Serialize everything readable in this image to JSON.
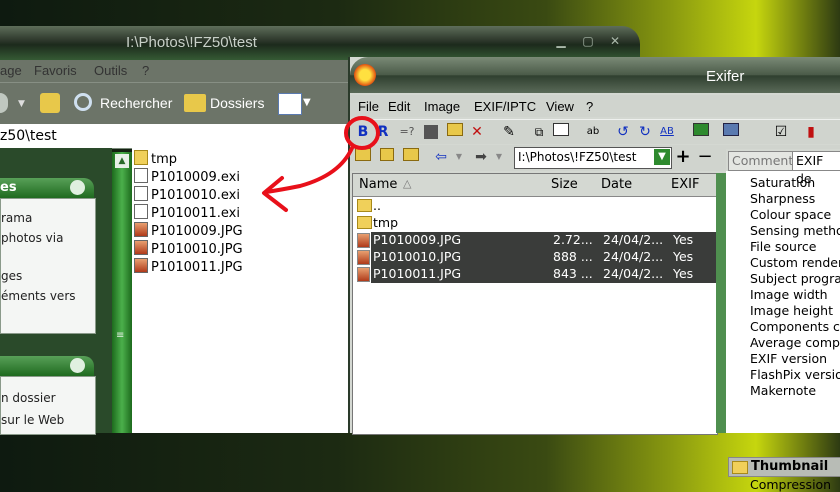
{
  "explorer": {
    "title": "I:\\Photos\\!FZ50\\test",
    "menu": [
      "age",
      "Favoris",
      "Outils",
      "?"
    ],
    "toolbar": {
      "search_label": "Rechercher",
      "folders_label": "Dossiers"
    },
    "address": "z50\\test",
    "pane1": {
      "header": "es",
      "items": [
        "rama",
        "photos via",
        "ges",
        "éments vers"
      ]
    },
    "pane2": {
      "items": [
        "n dossier",
        "sur le Web"
      ]
    },
    "files": [
      {
        "name": "tmp",
        "icon": "folder-icon"
      },
      {
        "name": "P1010009.exi",
        "icon": "document-icon"
      },
      {
        "name": "P1010010.exi",
        "icon": "document-icon"
      },
      {
        "name": "P1010011.exi",
        "icon": "document-icon"
      },
      {
        "name": "P1010009.JPG",
        "icon": "image-file-icon"
      },
      {
        "name": "P1010010.JPG",
        "icon": "image-file-icon"
      },
      {
        "name": "P1010011.JPG",
        "icon": "image-file-icon"
      }
    ]
  },
  "exifer": {
    "title": "Exifer",
    "menu": [
      "File",
      "Edit",
      "Image",
      "EXIF/IPTC",
      "View",
      "?"
    ],
    "toolbar": {
      "b_label": "B",
      "r_label": "R",
      "query_label": "=?"
    },
    "path": "I:\\Photos\\!FZ50\\test",
    "columns": {
      "name": "Name",
      "size": "Size",
      "date": "Date",
      "exif": "EXIF"
    },
    "rows": [
      {
        "name": "..",
        "size": "",
        "date": "",
        "exif": "",
        "selected": false,
        "icon": "folder-icon"
      },
      {
        "name": "tmp",
        "size": "",
        "date": "",
        "exif": "",
        "selected": false,
        "icon": "folder-icon"
      },
      {
        "name": "P1010009.JPG",
        "size": "2.72...",
        "date": "24/04/2...",
        "exif": "Yes",
        "selected": true,
        "icon": "image-file-icon"
      },
      {
        "name": "P1010010.JPG",
        "size": "888 ...",
        "date": "24/04/2...",
        "exif": "Yes",
        "selected": true,
        "icon": "image-file-icon"
      },
      {
        "name": "P1010011.JPG",
        "size": "843 ...",
        "date": "24/04/2...",
        "exif": "Yes",
        "selected": true,
        "icon": "image-file-icon"
      }
    ],
    "tabs": [
      "Comment",
      "EXIF de"
    ],
    "properties": [
      "Saturation",
      "Sharpness",
      "Colour space",
      "Sensing method",
      "File source",
      "Custom rendered",
      "Subject program",
      "Image width",
      "Image height",
      "Components co",
      "Average compr",
      "EXIF version",
      "FlashPix version",
      "Makernote"
    ],
    "thumbnail_header": "Thumbnail",
    "thumbnail_items": [
      "Compression"
    ]
  },
  "colors": {
    "accent_green": "#2e8a2e",
    "annotation_red": "#e8101a",
    "selection": "#3a3c3a"
  }
}
